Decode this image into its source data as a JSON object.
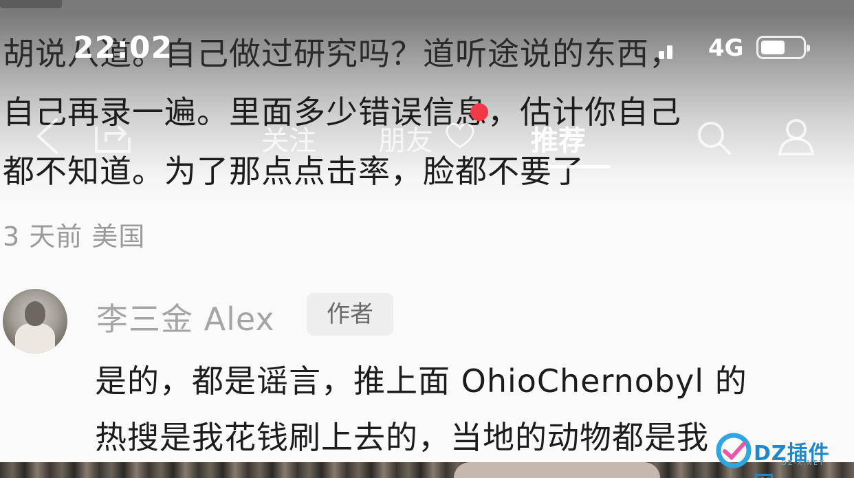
{
  "status_bar": {
    "time": "22:02",
    "network": "4G"
  },
  "nav": {
    "follow": "关注",
    "friends": "朋友",
    "recommend": "推荐",
    "icons": [
      "back-icon",
      "share-icon",
      "heart-icon",
      "search-icon",
      "user-icon"
    ]
  },
  "comment": {
    "lines": [
      "胡说八道。自己做过研究吗？道听途说的东西，",
      "自己再录一遍。里面多少错误信息，估计你自己",
      "都不知道。为了那点点击率，脸都不要了"
    ],
    "meta": "3 天前 美国"
  },
  "reply": {
    "name": "李三金 Alex",
    "badge": "作者",
    "lines": [
      "是的，都是谣言，推上面 OhioChernobyl 的",
      "热搜是我花钱刷上去的，当地的动物都是我"
    ]
  },
  "watermark": {
    "text": "DZ插件网",
    "sub": "DZ-X.NET"
  },
  "colors": {
    "red_dot": "#f03a47",
    "watermark": "#1e88c8"
  }
}
